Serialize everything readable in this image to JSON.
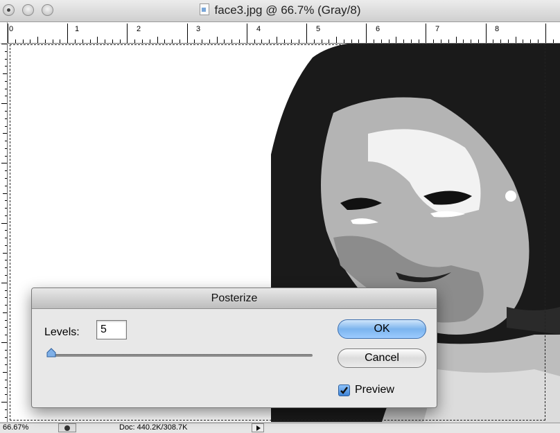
{
  "window": {
    "title": "face3.jpg @ 66.7% (Gray/8)"
  },
  "ruler": {
    "labels": [
      "0",
      "1",
      "2",
      "3",
      "4",
      "5",
      "6",
      "7",
      "8"
    ]
  },
  "status": {
    "zoom": "66.67%",
    "doc_info": "Doc: 440.2K/308.7K"
  },
  "dialog": {
    "title": "Posterize",
    "levels_label": "Levels:",
    "levels_value": "5",
    "levels_slider_fraction": 0.0,
    "ok_label": "OK",
    "cancel_label": "Cancel",
    "preview_label": "Preview",
    "preview_checked": true
  },
  "colors": {
    "ok_button": "#7cb4ee",
    "checkbox": "#3d83d6"
  }
}
